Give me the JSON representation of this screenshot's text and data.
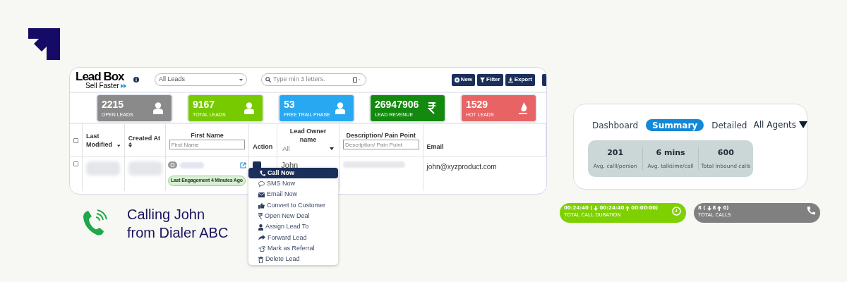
{
  "crm": {
    "logo": {
      "title": "Lead Box",
      "tagline": "Sell Faster"
    },
    "lead_filter": {
      "value": "All Leads"
    },
    "search": {
      "placeholder": "Type min 3 letters."
    },
    "buttons": [
      {
        "label": "New",
        "kind": "plus"
      },
      {
        "label": "Filter",
        "kind": "filter"
      },
      {
        "label": "Export",
        "kind": "download"
      }
    ],
    "stats": [
      {
        "value": "2215",
        "label": "OPEN LEADS",
        "color": "#8a8a8a",
        "kind": "person"
      },
      {
        "value": "9167",
        "label": "TOTAL LEADS",
        "color": "#77c900",
        "kind": "person"
      },
      {
        "value": "53",
        "label": "FREE TRAIL PHASE",
        "color": "#29a8f2",
        "kind": "person"
      },
      {
        "value": "26947906",
        "label": "LEAD REVENUE",
        "color": "#138a0f",
        "kind": "currency"
      },
      {
        "value": "1529",
        "label": "HOT LEADS",
        "color": "#e86464",
        "kind": "fire"
      }
    ],
    "table": {
      "select_all": {
        "checked": false
      },
      "columns": [
        {
          "label": "Last Modified",
          "kind": "sorted"
        },
        {
          "label": "Created At",
          "kind": "sortable"
        },
        {
          "label": "First Name",
          "kind": "text_filter",
          "placeholder": "First Name"
        },
        {
          "label": "Action",
          "kind": "plain"
        },
        {
          "label": "Lead Owner name",
          "kind": "select_filter",
          "value": "All"
        },
        {
          "label": "Description/ Pain Point",
          "kind": "text_filter",
          "placeholder": "Description/ Pain Point"
        },
        {
          "label": "Email",
          "kind": "plain"
        }
      ],
      "rows": [
        {
          "checked": false,
          "lead_owner": "John",
          "engagement": "Last Engagement 4 Minutes Ago",
          "email": "john@xyzproduct.com"
        }
      ]
    },
    "action_menu": {
      "items": [
        {
          "label": "Call Now",
          "selected": true
        },
        {
          "label": "SMS Now",
          "selected": false
        },
        {
          "label": "Email Now",
          "selected": false
        },
        {
          "label": "Convert to Customer",
          "selected": false
        },
        {
          "label": "Open New Deal",
          "selected": false
        },
        {
          "label": "Assign Lead To",
          "selected": false
        },
        {
          "label": "Forward Lead",
          "selected": false
        },
        {
          "label": "Mark as Referral",
          "selected": false
        },
        {
          "label": "Delete Lead",
          "selected": false
        }
      ]
    }
  },
  "call_notice": {
    "lines": [
      "Calling John",
      "from Dialer ABC"
    ]
  },
  "summary": {
    "tabs": [
      {
        "label": "Dashboard",
        "selected": false
      },
      {
        "label": "Summary",
        "selected": true
      },
      {
        "label": "Detailed",
        "selected": false
      }
    ],
    "agent_filter": "All Agents",
    "metrics": [
      {
        "value": "201",
        "label": "Avg. calll/person"
      },
      {
        "value": "6 mins",
        "label": "Avg. talktime/call"
      },
      {
        "value": "600",
        "label": "Total Inbound calls"
      }
    ]
  },
  "totals": [
    {
      "segments": [
        "00:24:40 (",
        "00:24:40",
        "00:00:00)"
      ],
      "label": "TOTAL CALL DURATION",
      "color": "#7ed000",
      "kind": "clock"
    },
    {
      "segments": [
        "8 (",
        "8",
        "0)"
      ],
      "label": "TOTAL CALLS",
      "color": "#808080",
      "kind": "phone"
    }
  ]
}
